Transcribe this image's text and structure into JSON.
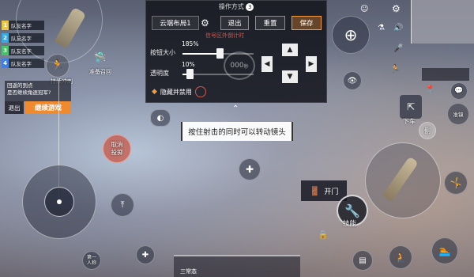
{
  "team": [
    {
      "num": "1",
      "name": "队友名字",
      "color": "#e8c64a"
    },
    {
      "num": "2",
      "name": "队友名字",
      "color": "#3fa7e0"
    },
    {
      "num": "3",
      "name": "队友名字",
      "color": "#4cc06a"
    },
    {
      "num": "4",
      "name": "队友名字",
      "color": "#3f7fe0"
    }
  ],
  "left_labels": {
    "sprint_hold": "持续冲刺",
    "return_prompt": "回返的到点\n是否继续角逐冠军?",
    "exit": "退出",
    "continue_game": "继续游戏",
    "cancel_throw": "取消\n投掷",
    "first_person": "第一\n人称",
    "call_vehicle": "准备召回"
  },
  "panel": {
    "title": "操作方式",
    "title_badge": "3",
    "layout_name": "云端布局1",
    "exit_label": "退出",
    "reset_label": "重置",
    "save_label": "保存",
    "hint_text": "信号区外倒计时",
    "size_label": "按钮大小",
    "size_value": "185%",
    "size_fraction": 0.52,
    "opacity_label": "透明度",
    "opacity_value": "10%",
    "opacity_fraction": 0.1,
    "hide_disable_label": "隐藏并禁用",
    "timer_placeholder": "000",
    "timer_unit": "秒"
  },
  "tooltip": "按住射击的同时可以转动镜头",
  "right_labels": {
    "get_off": "下车",
    "side": "侧",
    "skill": "技能",
    "open_door": "开门",
    "drive": "准镜"
  },
  "bottom_status": "三常态"
}
